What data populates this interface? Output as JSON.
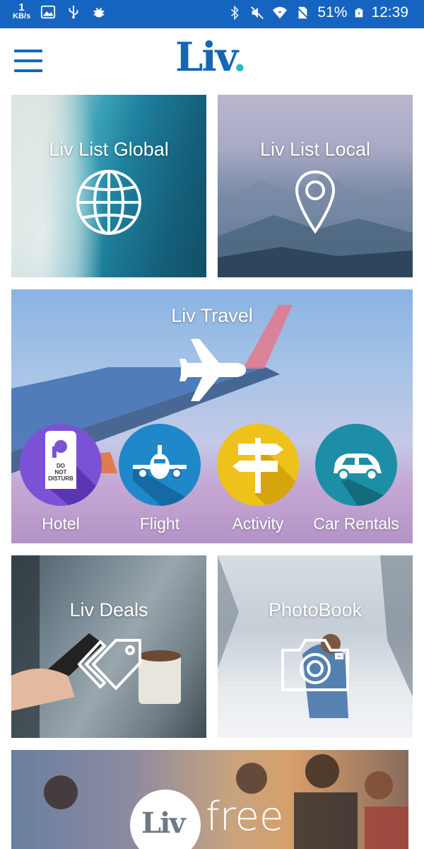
{
  "status_bar": {
    "speed_value": "1",
    "speed_unit": "KB/s",
    "battery": "51%",
    "time": "12:39",
    "icons": [
      "image-icon",
      "usb-icon",
      "android-debug-icon",
      "bluetooth-icon",
      "mute-icon",
      "wifi-icon",
      "no-sim-icon",
      "battery-icon"
    ]
  },
  "app_bar": {
    "menu_icon": "hamburger-menu-icon",
    "logo_text": "Liv",
    "logo_dot": ".",
    "brand_color": "#1566b5",
    "accent_color": "#27b9c4"
  },
  "tiles": {
    "global": {
      "title": "Liv List Global",
      "icon": "globe-icon"
    },
    "local": {
      "title": "Liv List Local",
      "icon": "location-pin-icon"
    },
    "travel": {
      "title": "Liv Travel",
      "icon": "airplane-icon",
      "items": [
        {
          "label": "Hotel",
          "icon": "do-not-disturb-sign-icon",
          "color": "#7b52d6"
        },
        {
          "label": "Flight",
          "icon": "plane-front-icon",
          "color": "#1e88c9"
        },
        {
          "label": "Activity",
          "icon": "signpost-icon",
          "color": "#eec21a"
        },
        {
          "label": "Car Rentals",
          "icon": "car-icon",
          "color": "#1c8fa6"
        }
      ]
    },
    "deals": {
      "title": "Liv Deals",
      "icon": "tag-icon"
    },
    "photobook": {
      "title": "PhotoBook",
      "icon": "camera-icon"
    },
    "free": {
      "logo_text": "Liv",
      "text": "free"
    }
  }
}
